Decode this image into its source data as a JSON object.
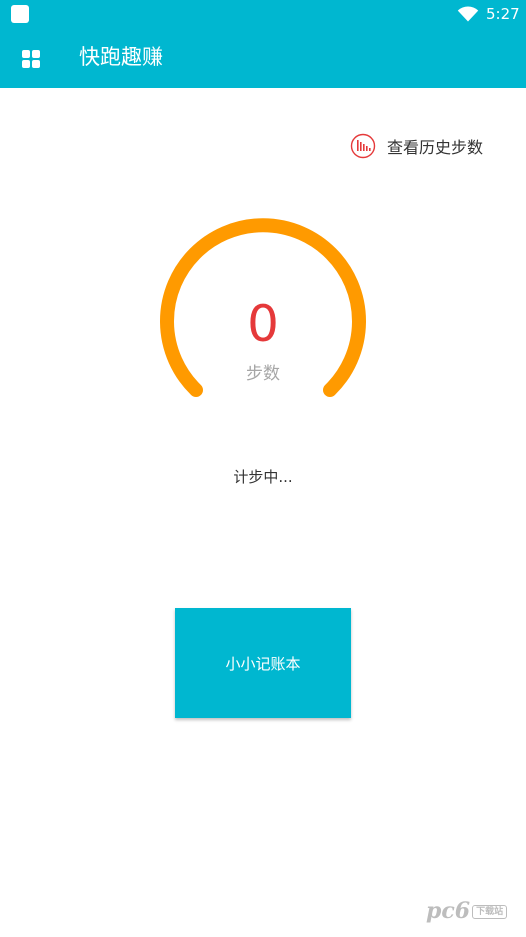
{
  "status_bar": {
    "time": "5:27"
  },
  "app_bar": {
    "title": "快跑趣赚",
    "menu_icon": "grid-menu-icon"
  },
  "history": {
    "label": "查看历史步数",
    "icon": "bar-chart-circle-icon",
    "icon_color": "#e5393a"
  },
  "gauge": {
    "value": "0",
    "unit": "步数",
    "arc_color": "#ff9a00",
    "value_color": "#e5393a"
  },
  "counting_status": "计步中...",
  "button": {
    "label": "小小记账本"
  },
  "colors": {
    "primary": "#00b7d0",
    "white": "#ffffff",
    "text_dark": "#333333",
    "text_muted": "#a6a6a6"
  },
  "watermark": {
    "text": "pc6",
    "badge": "下载站"
  }
}
